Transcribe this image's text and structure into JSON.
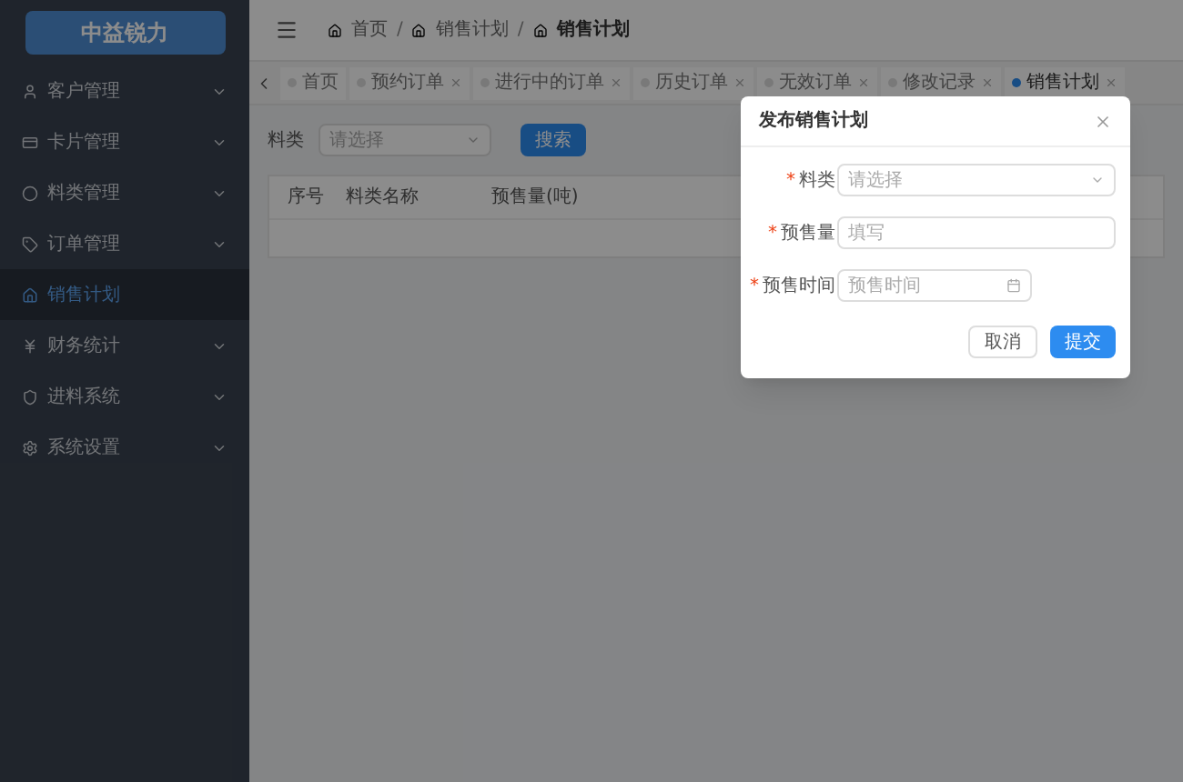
{
  "logo": {
    "text": "中益锐力"
  },
  "sidebar": {
    "items": [
      {
        "label": "客户管理",
        "selected": false,
        "expandable": true
      },
      {
        "label": "卡片管理",
        "selected": false,
        "expandable": true
      },
      {
        "label": "料类管理",
        "selected": false,
        "expandable": true
      },
      {
        "label": "订单管理",
        "selected": false,
        "expandable": true
      },
      {
        "label": "销售计划",
        "selected": true,
        "expandable": false
      },
      {
        "label": "财务统计",
        "selected": false,
        "expandable": true
      },
      {
        "label": "进料系统",
        "selected": false,
        "expandable": true
      },
      {
        "label": "系统设置",
        "selected": false,
        "expandable": true
      }
    ]
  },
  "breadcrumb": {
    "separator": "/",
    "items": [
      {
        "label": "首页"
      },
      {
        "label": "销售计划"
      },
      {
        "label": "销售计划"
      }
    ]
  },
  "tabs": [
    {
      "label": "首页",
      "selected": false,
      "closable": false
    },
    {
      "label": "预约订单",
      "selected": false,
      "closable": true
    },
    {
      "label": "进行中的订单",
      "selected": false,
      "closable": true
    },
    {
      "label": "历史订单",
      "selected": false,
      "closable": true
    },
    {
      "label": "无效订单",
      "selected": false,
      "closable": true
    },
    {
      "label": "修改记录",
      "selected": false,
      "closable": true
    },
    {
      "label": "销售计划",
      "selected": true,
      "closable": true
    }
  ],
  "filter": {
    "label": "料类",
    "placeholder": "请选择",
    "button": "搜索"
  },
  "table": {
    "columns": [
      "序号",
      "料类名称",
      "预售量(吨)"
    ]
  },
  "dialog": {
    "title": "发布销售计划",
    "required_mark": "*",
    "fields": [
      {
        "label": "料类",
        "kind": "select",
        "placeholder": "请选择",
        "required": true
      },
      {
        "label": "预售量",
        "kind": "text",
        "placeholder": "填写",
        "required": true
      },
      {
        "label": "预售时间",
        "kind": "date",
        "placeholder": "预售时间",
        "required": true
      }
    ],
    "buttons": [
      {
        "label": "取消",
        "primary": false
      },
      {
        "label": "提交",
        "primary": true
      }
    ]
  }
}
